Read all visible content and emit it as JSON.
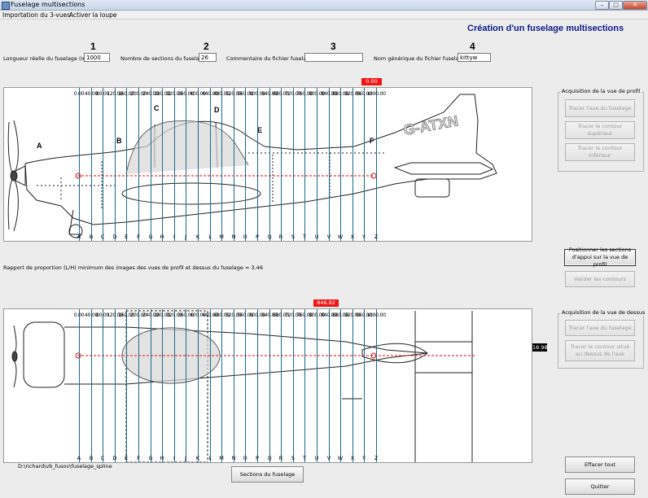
{
  "window": {
    "title": "Fuselage multisections"
  },
  "menu": [
    "Importation du 3-vues",
    "Activer la loupe"
  ],
  "app_title": "Création d'un fuselage multisections",
  "steps": [
    {
      "num": "1",
      "label": "Longueur réelle du fuselage (mm)",
      "value": "1000"
    },
    {
      "num": "2",
      "label": "Nombre de sections du fuselage",
      "value": "26"
    },
    {
      "num": "3",
      "label": "Commentaire du fichier fuselage",
      "value": ""
    },
    {
      "num": "4",
      "label": "Nom générique du fichier fuselage",
      "value": "kittyw"
    }
  ],
  "profile": {
    "marker_value": "0.00",
    "callouts": [
      "A",
      "B",
      "C",
      "D",
      "E",
      "F"
    ],
    "registration": "G-ATXN"
  },
  "top_view": {
    "marker_value": "846.82",
    "side_value": "18.98"
  },
  "ticks": [
    "0.00",
    "40.00",
    "80.00",
    "120.00",
    "160.00",
    "200.00",
    "240.00",
    "280.00",
    "320.00",
    "360.00",
    "400.00",
    "440.00",
    "480.00",
    "520.00",
    "560.00",
    "600.00",
    "640.00",
    "680.00",
    "720.00",
    "760.00",
    "800.00",
    "840.00",
    "880.00",
    "920.00",
    "960.00",
    "1000.00"
  ],
  "letters": [
    "A",
    "B",
    "C",
    "D",
    "E",
    "F",
    "G",
    "H",
    "I",
    "J",
    "K",
    "L",
    "M",
    "N",
    "O",
    "P",
    "Q",
    "R",
    "S",
    "T",
    "U",
    "V",
    "W",
    "X",
    "Y",
    "Z"
  ],
  "proportion_text": "Rapport de proportion (L/H) minimum des images des vues de profil et dessus du fuselage = 3.46",
  "profile_group": {
    "title": "Acquisition de la vue de profil",
    "buttons": [
      "Tracer l'axe du fuselage",
      "Tracer le contour supérieur",
      "Tracer le contour inférieur"
    ]
  },
  "mid_buttons": {
    "position": "Positionner les sections d'appui sur la vue de profil",
    "validate": "Valider les contours"
  },
  "top_group": {
    "title": "Acquisition de la vue de dessus",
    "buttons": [
      "Tracer l'axe du fuselage",
      "Tracer le contour situé au dessus de l'axe"
    ]
  },
  "file_path": "D:\\richard\\vb_fusov\\fuselage_spline",
  "buttons": {
    "sections": "Sections du fuselage",
    "clear": "Effacer tout",
    "quit": "Quitter"
  }
}
